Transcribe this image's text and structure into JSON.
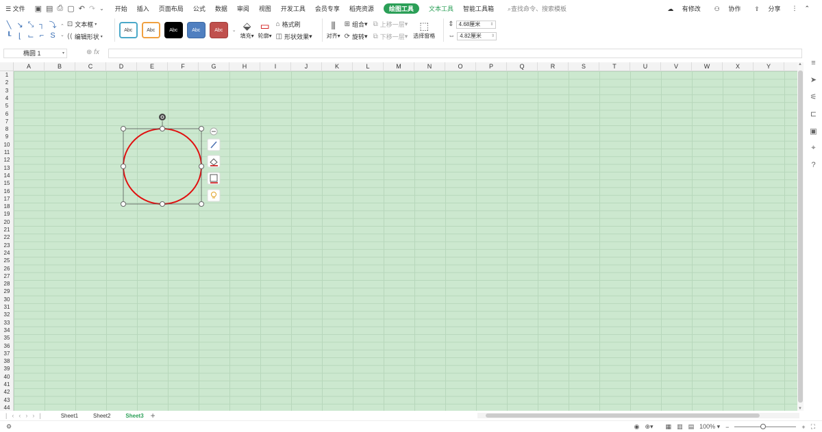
{
  "menubar": {
    "file": "文件",
    "tabs": [
      "开始",
      "插入",
      "页面布局",
      "公式",
      "数据",
      "审阅",
      "视图",
      "开发工具",
      "会员专享",
      "稻壳资源"
    ],
    "drawing_tools": "绘图工具",
    "text_tools": "文本工具",
    "smart_toolbox": "智能工具箱",
    "search_placeholder": "查找命令、搜索模板",
    "has_changes": "有修改",
    "collaborate": "协作",
    "share": "分享"
  },
  "ribbon": {
    "text_box": "文本框",
    "edit_shape": "编辑形状",
    "style_buttons": [
      {
        "label": "Abc",
        "bg": "#ffffff",
        "border": "#4aa8c8",
        "color": "#333333"
      },
      {
        "label": "Abc",
        "bg": "#ffffff",
        "border": "#f0a040",
        "color": "#333333"
      },
      {
        "label": "Abc",
        "bg": "#000000",
        "border": "#000000",
        "color": "#ffffff"
      },
      {
        "label": "Abc",
        "bg": "#4f7fc0",
        "border": "#3a66a0",
        "color": "#ffffff"
      },
      {
        "label": "Abc",
        "bg": "#c0504d",
        "border": "#a03c3a",
        "color": "#ffffff"
      }
    ],
    "fill": "填充",
    "outline": "轮廓",
    "format_painter": "格式刷",
    "shape_effects": "形状效果",
    "align": "对齐",
    "group": "组合",
    "rotate": "旋转",
    "bring_forward": "上移一层",
    "send_backward": "下移一层",
    "selection_pane": "选择窗格",
    "height": "4.68厘米",
    "width": "4.82厘米"
  },
  "formula_bar": {
    "name_box": "椭圆 1",
    "fx": "fx"
  },
  "grid": {
    "columns": [
      "A",
      "B",
      "C",
      "D",
      "E",
      "F",
      "G",
      "H",
      "I",
      "J",
      "K",
      "L",
      "M",
      "N",
      "O",
      "P",
      "Q",
      "R",
      "S",
      "T",
      "U",
      "V",
      "W",
      "X",
      "Y"
    ],
    "rows": [
      "1",
      "2",
      "3",
      "4",
      "5",
      "6",
      "7",
      "8",
      "9",
      "10",
      "11",
      "12",
      "13",
      "14",
      "15",
      "16",
      "17",
      "18",
      "19",
      "20",
      "21",
      "22",
      "23",
      "24",
      "25",
      "26",
      "27",
      "28",
      "29",
      "30",
      "31",
      "32",
      "33",
      "34",
      "35",
      "36",
      "37",
      "38",
      "39",
      "40",
      "41",
      "42",
      "43",
      "44"
    ],
    "shape_stroke": "#e01010"
  },
  "sheets": {
    "tabs": [
      "Sheet1",
      "Sheet2",
      "Sheet3"
    ],
    "active": "Sheet3"
  },
  "statusbar": {
    "zoom": "100%"
  },
  "colors": {
    "accent": "#2b9f57",
    "grid_bg": "#cce8cf"
  }
}
